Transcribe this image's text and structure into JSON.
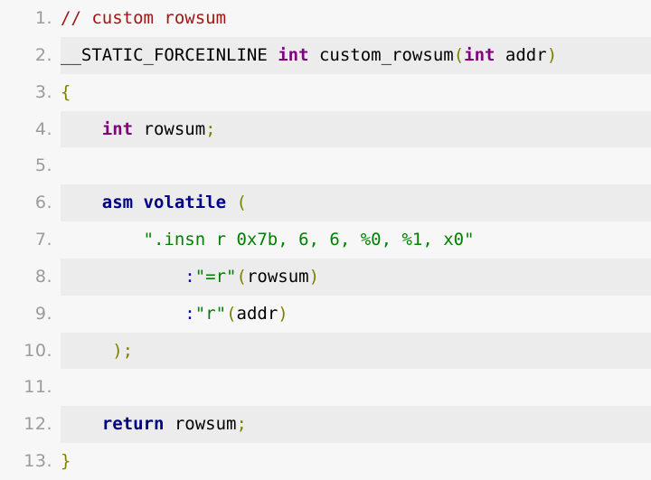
{
  "listing": {
    "language": "c",
    "background_color": "#f7f7f7",
    "alt_row_color": "#ececec",
    "gutter_color": "#9b9b9b",
    "line_number_suffix": ".",
    "lines": [
      {
        "number": "1.",
        "highlighted": false,
        "text": "// custom rowsum",
        "tokens": [
          {
            "t": "// custom rowsum",
            "c": "tok-comment"
          }
        ]
      },
      {
        "number": "2.",
        "highlighted": true,
        "text": "__STATIC_FORCEINLINE int custom_rowsum(int addr)",
        "tokens": [
          {
            "t": "__STATIC_FORCEINLINE ",
            "c": "tok-plain"
          },
          {
            "t": "int",
            "c": "tok-type"
          },
          {
            "t": " custom_rowsum",
            "c": "tok-ident"
          },
          {
            "t": "(",
            "c": "tok-punct"
          },
          {
            "t": "int",
            "c": "tok-type"
          },
          {
            "t": " addr",
            "c": "tok-ident"
          },
          {
            "t": ")",
            "c": "tok-punct"
          }
        ]
      },
      {
        "number": "3.",
        "highlighted": false,
        "text": "{",
        "tokens": [
          {
            "t": "{",
            "c": "tok-punct"
          }
        ]
      },
      {
        "number": "4.",
        "highlighted": true,
        "text": "    int rowsum;",
        "tokens": [
          {
            "t": "    ",
            "c": "tok-plain"
          },
          {
            "t": "int",
            "c": "tok-type"
          },
          {
            "t": " rowsum",
            "c": "tok-ident"
          },
          {
            "t": ";",
            "c": "tok-punct"
          }
        ]
      },
      {
        "number": "5.",
        "highlighted": false,
        "text": "",
        "tokens": []
      },
      {
        "number": "6.",
        "highlighted": true,
        "text": "    asm volatile (",
        "tokens": [
          {
            "t": "    ",
            "c": "tok-plain"
          },
          {
            "t": "asm volatile",
            "c": "tok-keyword"
          },
          {
            "t": " ",
            "c": "tok-plain"
          },
          {
            "t": "(",
            "c": "tok-punct"
          }
        ]
      },
      {
        "number": "7.",
        "highlighted": false,
        "text": "        \".insn r 0x7b, 6, 6, %0, %1, x0\"",
        "tokens": [
          {
            "t": "        ",
            "c": "tok-plain"
          },
          {
            "t": "\".insn r 0x7b, 6, 6, %0, %1, x0\"",
            "c": "tok-string"
          }
        ]
      },
      {
        "number": "8.",
        "highlighted": true,
        "text": "            :\"=r\"(rowsum)",
        "tokens": [
          {
            "t": "            ",
            "c": "tok-plain"
          },
          {
            "t": ":",
            "c": "tok-operator"
          },
          {
            "t": "\"=r\"",
            "c": "tok-string"
          },
          {
            "t": "(",
            "c": "tok-punct"
          },
          {
            "t": "rowsum",
            "c": "tok-ident"
          },
          {
            "t": ")",
            "c": "tok-punct"
          }
        ]
      },
      {
        "number": "9.",
        "highlighted": false,
        "text": "            :\"r\"(addr)",
        "tokens": [
          {
            "t": "            ",
            "c": "tok-plain"
          },
          {
            "t": ":",
            "c": "tok-operator"
          },
          {
            "t": "\"r\"",
            "c": "tok-string"
          },
          {
            "t": "(",
            "c": "tok-punct"
          },
          {
            "t": "addr",
            "c": "tok-ident"
          },
          {
            "t": ")",
            "c": "tok-punct"
          }
        ]
      },
      {
        "number": "10.",
        "highlighted": true,
        "text": "     );",
        "tokens": [
          {
            "t": "     ",
            "c": "tok-plain"
          },
          {
            "t": ");",
            "c": "tok-punct"
          }
        ]
      },
      {
        "number": "11.",
        "highlighted": false,
        "text": "",
        "tokens": []
      },
      {
        "number": "12.",
        "highlighted": true,
        "text": "    return rowsum;",
        "tokens": [
          {
            "t": "    ",
            "c": "tok-plain"
          },
          {
            "t": "return",
            "c": "tok-keyword"
          },
          {
            "t": " rowsum",
            "c": "tok-ident"
          },
          {
            "t": ";",
            "c": "tok-punct"
          }
        ]
      },
      {
        "number": "13.",
        "highlighted": false,
        "text": "}",
        "tokens": [
          {
            "t": "}",
            "c": "tok-punct"
          }
        ]
      }
    ]
  }
}
